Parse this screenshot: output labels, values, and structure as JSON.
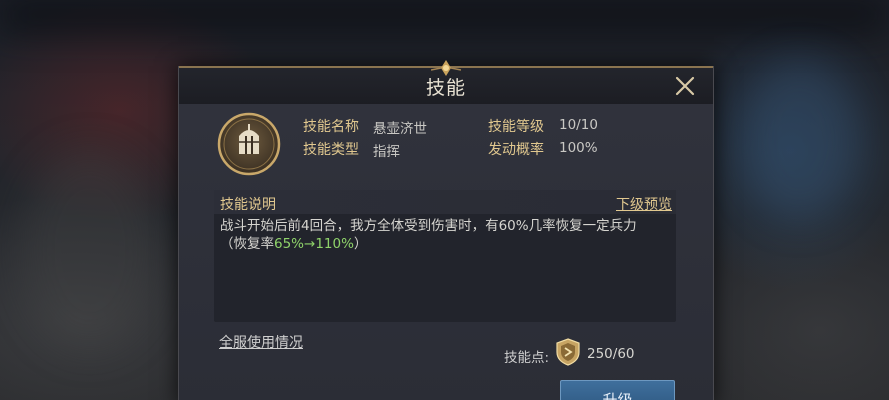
{
  "dialog": {
    "title": "技能",
    "close_icon": "close-icon"
  },
  "skill": {
    "icon": "knight-helmet-icon",
    "name_label": "技能名称",
    "name_value": "悬壶济世",
    "type_label": "技能类型",
    "type_value": "指挥",
    "level_label": "技能等级",
    "level_value": "10/10",
    "rate_label": "发动概率",
    "rate_value": "100%"
  },
  "description": {
    "title": "技能说明",
    "next_level_link": "下级预览",
    "line1": "战斗开始后前4回合，我方全体受到伤害时，有60%几率恢复一定兵力",
    "line2_prefix": "（恢复率",
    "line2_highlight": "65%→110%",
    "line2_suffix": "）"
  },
  "footer": {
    "usage_link": "全服使用情况",
    "points_label": "技能点:",
    "points_icon": "skill-point-shield-icon",
    "points_value": "250/60",
    "upgrade_label": "升级"
  },
  "colors": {
    "gold_label": "#e1c88f",
    "highlight_green": "#8fd36a",
    "button_blue": "#3f6f9c"
  }
}
